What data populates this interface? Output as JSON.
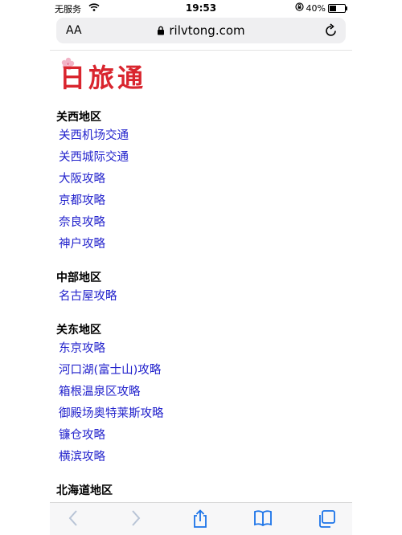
{
  "status_bar": {
    "carrier": "无服务",
    "time": "19:53",
    "battery": "40%"
  },
  "url_bar": {
    "aa_label": "AA",
    "address": "rilvtong.com"
  },
  "logo_text": "日旅通",
  "sections": [
    {
      "title": "关西地区",
      "links": [
        "关西机场交通",
        "关西城际交通",
        "大阪攻略",
        "京都攻略",
        "奈良攻略",
        "神户攻略"
      ]
    },
    {
      "title": "中部地区",
      "links": [
        "名古屋攻略"
      ]
    },
    {
      "title": "关东地区",
      "links": [
        "东京攻略",
        "河口湖(富士山)攻略",
        "箱根温泉区攻略",
        "御殿场奥特莱斯攻略",
        "镰仓攻略",
        "横滨攻略"
      ]
    },
    {
      "title": "北海道地区",
      "links": []
    }
  ],
  "colors": {
    "link": "#2222cc",
    "logo_red": "#d9252e",
    "toolbar_active": "#1a73e8",
    "toolbar_disabled": "#b8c4d6"
  },
  "icons": [
    "wifi-icon",
    "orientation-lock-icon",
    "battery-icon",
    "lock-icon",
    "reload-icon",
    "back-icon",
    "forward-icon",
    "share-icon",
    "bookmarks-icon",
    "tabs-icon"
  ]
}
